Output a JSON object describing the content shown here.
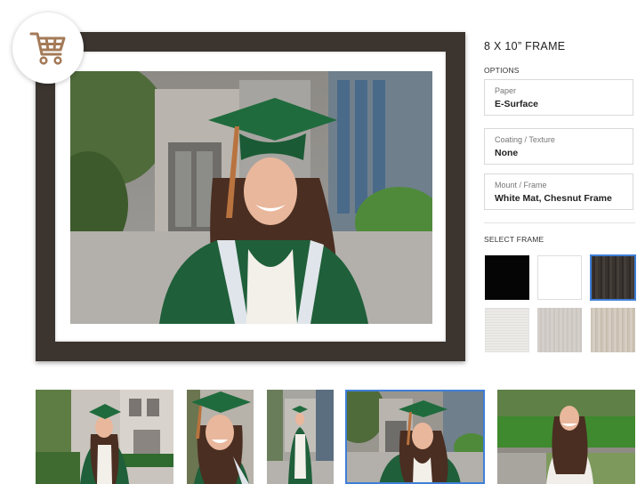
{
  "product": {
    "title": "8 X 10” FRAME"
  },
  "options": {
    "heading": "OPTIONS",
    "items": [
      {
        "label": "Paper",
        "value": "E-Surface"
      },
      {
        "label": "Coating / Texture",
        "value": "None"
      },
      {
        "label": "Mount / Frame",
        "value": "White Mat, Chesnut Frame"
      }
    ]
  },
  "frame_select": {
    "heading": "SELECT FRAME",
    "swatches": [
      {
        "name": "black",
        "color": "#050505",
        "selected": false
      },
      {
        "name": "white",
        "color": "#ffffff",
        "selected": false
      },
      {
        "name": "chestnut",
        "color": "#3a3430",
        "selected": true
      },
      {
        "name": "white-wash",
        "color": "#ecebe8",
        "selected": false
      },
      {
        "name": "light-gray",
        "color": "#d4cfca",
        "selected": false
      },
      {
        "name": "driftwood",
        "color": "#ccc3b6",
        "selected": false
      }
    ]
  },
  "icons": {
    "cart": "shopping-cart-icon"
  },
  "colors": {
    "accent_selected": "#3f7fd6",
    "cart_icon": "#a47a58",
    "frame_color": "#3b342f",
    "gown_green": "#1f5f3a"
  },
  "thumbnails": [
    {
      "name": "thumb-campus-building",
      "selected": false
    },
    {
      "name": "thumb-closeup-smile",
      "selected": false
    },
    {
      "name": "thumb-full-length",
      "selected": false
    },
    {
      "name": "thumb-current",
      "selected": true
    },
    {
      "name": "thumb-garden-hedge",
      "selected": false
    }
  ]
}
